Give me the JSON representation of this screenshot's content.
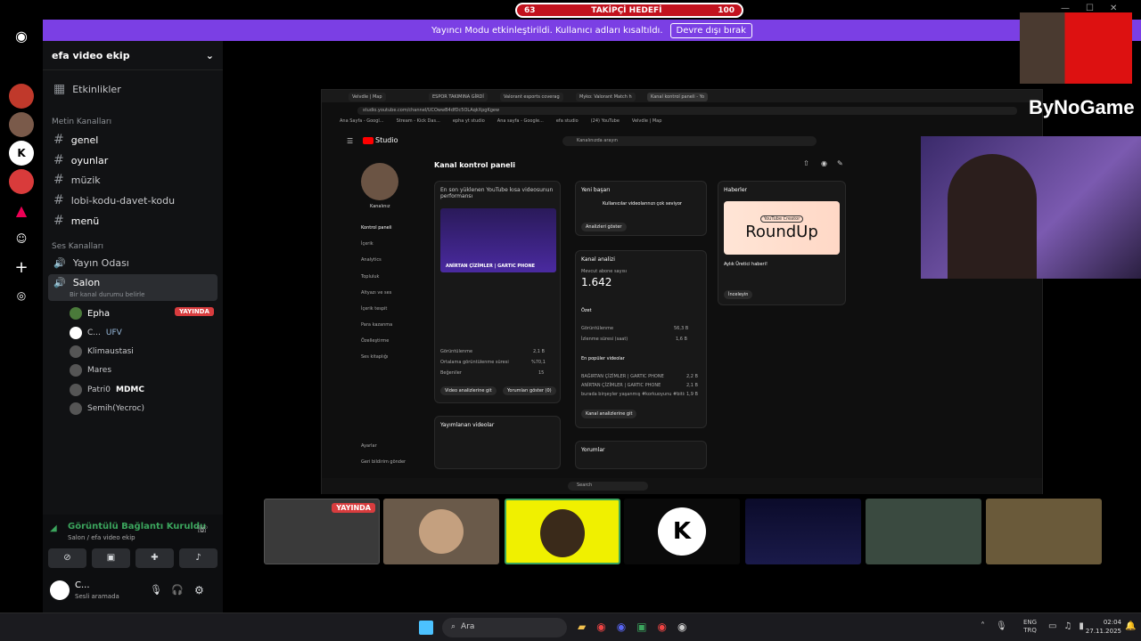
{
  "goal_bar": {
    "left": "63",
    "title": "TAKİPÇİ HEDEFİ",
    "right": "100"
  },
  "banner": {
    "text": "Yayıncı Modu etkinleştirildi. Kullanıcı adları kısaltıldı.",
    "button": "Devre dışı bırak"
  },
  "server": {
    "name": "efa video ekip"
  },
  "sidebar": {
    "events": "Etkinlikler",
    "text_category": "Metin Kanalları",
    "text_channels": [
      "genel",
      "oyunlar",
      "müzik",
      "lobi-kodu-davet-kodu",
      "menü"
    ],
    "voice_category": "Ses Kanalları",
    "voice_channels": [
      "Yayın Odası",
      "Salon"
    ],
    "salon_status": "Bir kanal durumu belirle",
    "members": [
      "Epha",
      "C...",
      "Klimaustasi",
      "Mares",
      "Patri0",
      "Semih(Yecroc)"
    ],
    "member_tags": {
      "c_tag": "UFV",
      "patri_tag": "MDMC"
    },
    "live_badge": "YAYINDA"
  },
  "voice_panel": {
    "status": "Görüntülü Bağlantı Kuruldu",
    "location": "Salon / efa video ekip"
  },
  "user_panel": {
    "name": "C...",
    "status": "Sesli aramada"
  },
  "stream": {
    "tabs": [
      "Velvdle | Map",
      "ESPOR TAKIMINA GİRDİ",
      "Valorant esports coverag",
      "Myko: Valorant Match h",
      "Kanal kontrol paneli - Yo"
    ],
    "url": "studio.youtube.com/channel/UCOwwB4dfDc5OLAqkXpgKgew",
    "bookmarks": [
      "Ana Sayfa - Googl...",
      "Stream - Kick Das...",
      "epha yt studio",
      "Ana sayfa - Google...",
      "efa studio",
      "(24) YouTube",
      "Velvdle | Map"
    ],
    "studio_label": "Studio",
    "search_placeholder": "Kanalınızda arayın",
    "channel_caption": "Kanalınız",
    "page_title": "Kanal kontrol paneli",
    "nav": [
      "Kontrol paneli",
      "İçerik",
      "Analytics",
      "Topluluk",
      "Altyazı ve ses",
      "İçerik tespit",
      "Para kazanma",
      "Özelleştirme",
      "Ses kitaplığı",
      "Ayarlar",
      "Geri bildirim gönder"
    ],
    "latest": {
      "title": "En son yüklenen YouTube kısa videosunun performansı",
      "thumb_caption": "ANİRTAN ÇİZİMLER | GARTIC PHONE",
      "views": "Görüntülenme",
      "views_val": "2,1 B",
      "watch": "Ortalama görüntülenme süresi",
      "watch_val": "%70,1",
      "likes": "Beğeniler",
      "likes_val": "15",
      "btn1": "Video analizlerine git",
      "btn2": "Yorumları göster (0)"
    },
    "news": {
      "title": "Yeni başarı",
      "text": "Kullanıcılar videolarınızı çok seviyor",
      "btn": "Analizleri göster"
    },
    "analytics": {
      "title": "Kanal analizi",
      "subs_label": "Mevcut abone sayısı",
      "subs": "1.642",
      "summary": "Özet",
      "views": "Görüntülenme",
      "views_val": "56,3 B",
      "watch": "İzlenme süresi (saat)",
      "watch_val": "1,6 B",
      "top": "En popüler videolar",
      "top_items": [
        "BAĞIRTAN ÇİZİMLER | GARTIC PHONE",
        "ANİRTAN ÇİZİMLER | GARTIC PHONE",
        "burada birşeyler yaşanmış #korkuoyunu #bitis3"
      ],
      "top_vals": [
        "2,2 B",
        "2,1 B",
        "1,9 B"
      ],
      "btn": "Kanal analizlerine git"
    },
    "haberler": {
      "title": "Haberler",
      "badge": "YouTube Creator",
      "hero": "RoundUp",
      "headline": "Aylık Üretici haberi!",
      "cta": "İnceleyin"
    },
    "published": {
      "title": "Yayımlanan videolar"
    },
    "comments": {
      "title": "Yorumlar"
    },
    "taskbar_search": "Search"
  },
  "stream_tiles": [
    "YAYINDA"
  ],
  "watermark": "ByNoGame",
  "taskbar": {
    "search": "Ara",
    "lang1": "ENG",
    "lang2": "TRQ",
    "time": "02:04",
    "date": "27.11.2025"
  }
}
